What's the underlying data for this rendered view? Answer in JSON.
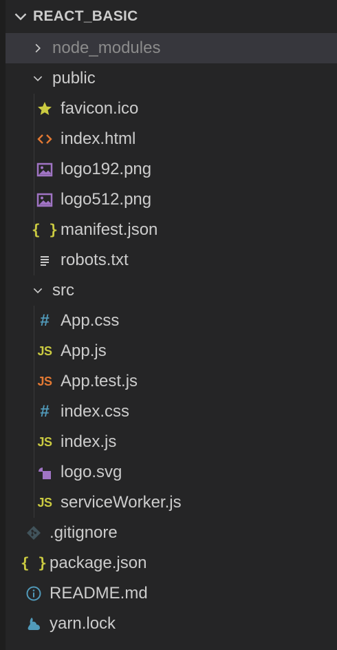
{
  "explorer": {
    "section_title": "REACT_BASIC",
    "items": [
      {
        "label": "node_modules",
        "kind": "folder",
        "expanded": false,
        "depth": 0,
        "icon": "chevron-right-icon"
      },
      {
        "label": "public",
        "kind": "folder",
        "expanded": true,
        "depth": 0,
        "icon": "chevron-down-icon"
      },
      {
        "label": "favicon.ico",
        "kind": "file",
        "depth": 1,
        "icon": "star-icon"
      },
      {
        "label": "index.html",
        "kind": "file",
        "depth": 1,
        "icon": "html-code-icon"
      },
      {
        "label": "logo192.png",
        "kind": "file",
        "depth": 1,
        "icon": "image-icon"
      },
      {
        "label": "logo512.png",
        "kind": "file",
        "depth": 1,
        "icon": "image-icon"
      },
      {
        "label": "manifest.json",
        "kind": "file",
        "depth": 1,
        "icon": "json-braces-icon"
      },
      {
        "label": "robots.txt",
        "kind": "file",
        "depth": 1,
        "icon": "text-lines-icon"
      },
      {
        "label": "src",
        "kind": "folder",
        "expanded": true,
        "depth": 0,
        "icon": "chevron-down-icon"
      },
      {
        "label": "App.css",
        "kind": "file",
        "depth": 1,
        "icon": "css-hash-icon"
      },
      {
        "label": "App.js",
        "kind": "file",
        "depth": 1,
        "icon": "js-icon"
      },
      {
        "label": "App.test.js",
        "kind": "file",
        "depth": 1,
        "icon": "js-test-icon"
      },
      {
        "label": "index.css",
        "kind": "file",
        "depth": 1,
        "icon": "css-hash-icon"
      },
      {
        "label": "index.js",
        "kind": "file",
        "depth": 1,
        "icon": "js-icon"
      },
      {
        "label": "logo.svg",
        "kind": "file",
        "depth": 1,
        "icon": "svg-shapes-icon"
      },
      {
        "label": "serviceWorker.js",
        "kind": "file",
        "depth": 1,
        "icon": "js-icon"
      },
      {
        "label": ".gitignore",
        "kind": "file",
        "depth": 0,
        "icon": "git-icon"
      },
      {
        "label": "package.json",
        "kind": "file",
        "depth": 0,
        "icon": "json-braces-icon"
      },
      {
        "label": "README.md",
        "kind": "file",
        "depth": 0,
        "icon": "info-icon"
      },
      {
        "label": "yarn.lock",
        "kind": "file",
        "depth": 0,
        "icon": "yarn-icon"
      }
    ],
    "icon_glyphs": {
      "js": "JS",
      "css": "#",
      "json": "{ }"
    },
    "colors": {
      "sidebar_bg": "#252526",
      "selected_bg": "#37373d",
      "text": "#cccccc",
      "dim_text": "#8b8b8b",
      "js_yellow": "#cbcb41",
      "test_orange": "#e37933",
      "css_blue": "#519aba",
      "html_orange": "#e37933",
      "image_purple": "#a074c4",
      "git_gray": "#41535b",
      "info_blue": "#519aba",
      "yarn_blue": "#519aba"
    }
  }
}
